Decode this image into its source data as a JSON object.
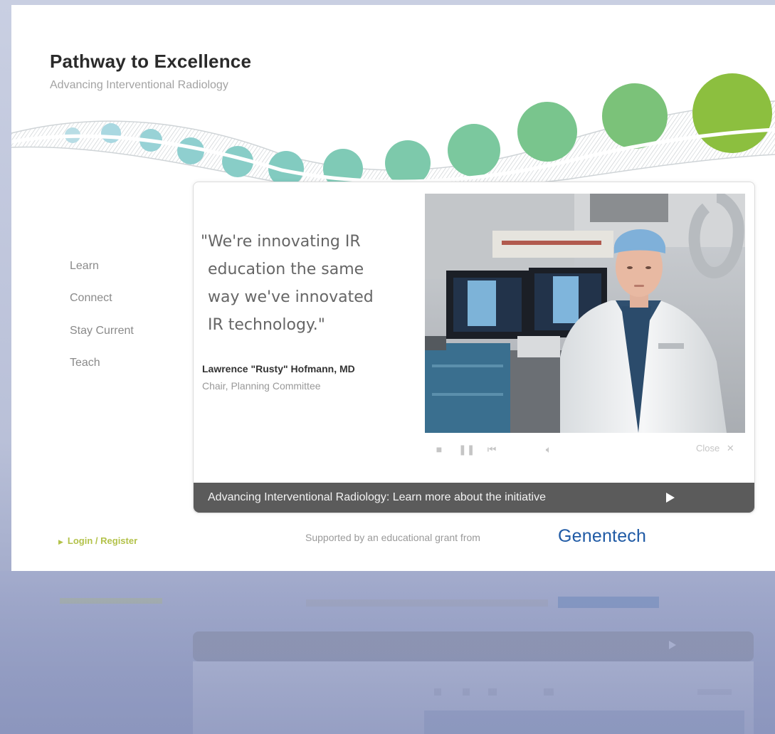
{
  "site": {
    "title": "Pathway to Excellence",
    "subtitle": "Advancing Interventional Radiology"
  },
  "nav": {
    "items": [
      {
        "label": "Learn"
      },
      {
        "label": "Connect"
      },
      {
        "label": "Stay Current"
      },
      {
        "label": "Teach"
      }
    ],
    "login_label": "Login / Register"
  },
  "feature": {
    "quote_lines": [
      "\"We're innovating IR",
      "education the same",
      "way we've innovated",
      "IR technology.\""
    ],
    "speaker_name": "Lawrence \"Rusty\" Hofmann, MD",
    "speaker_role": "Chair, Planning Committee",
    "close_label": "Close",
    "banner_text": "Advancing Interventional Radiology: Learn more about the initiative"
  },
  "footer": {
    "support_text": "Supported by an educational grant from",
    "sponsor": "Genentech"
  },
  "icons": {
    "stop": "stop-icon",
    "pause": "pause-icon",
    "skip_back": "skip-back-icon",
    "volume": "volume-icon",
    "close": "close-icon",
    "play": "play-arrow-icon"
  },
  "colors": {
    "title": "#2a2a2a",
    "accent_green": "#8cbf3f",
    "teal": "#7cc9b1",
    "banner": "#5b5b5b",
    "login": "#b3c24a",
    "sponsor_blue": "#1f5aa5"
  }
}
